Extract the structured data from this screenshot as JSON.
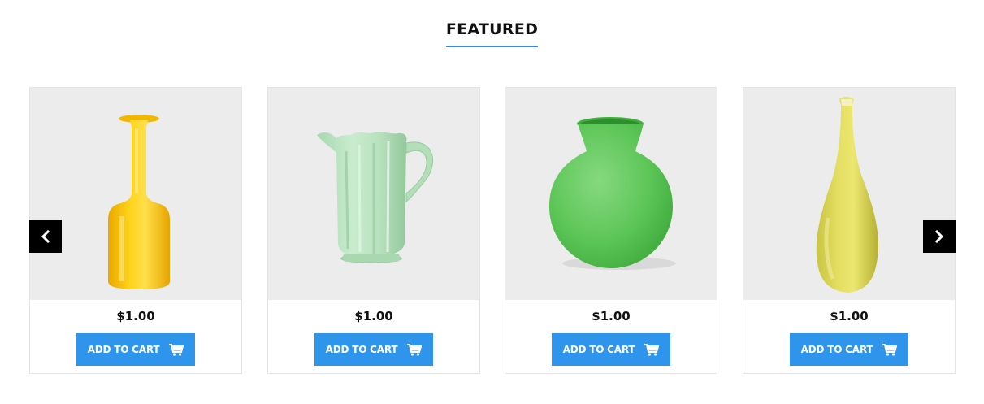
{
  "section": {
    "title": "FEATURED"
  },
  "products": [
    {
      "image_icon": "yellow-bottle-vase",
      "price": "$1.00",
      "button_label": "ADD TO CART"
    },
    {
      "image_icon": "green-glass-pitcher",
      "price": "$1.00",
      "button_label": "ADD TO CART"
    },
    {
      "image_icon": "green-round-vase",
      "price": "$1.00",
      "button_label": "ADD TO CART"
    },
    {
      "image_icon": "yellow-tall-vase",
      "price": "$1.00",
      "button_label": "ADD TO CART"
    }
  ],
  "controls": {
    "prev_icon": "chevron-left-icon",
    "next_icon": "chevron-right-icon",
    "cart_icon": "cart-icon"
  },
  "colors": {
    "accent": "#2f95ec",
    "underline": "#2f8ee6",
    "image_bg": "#ececec",
    "arrow_bg": "#000000"
  }
}
